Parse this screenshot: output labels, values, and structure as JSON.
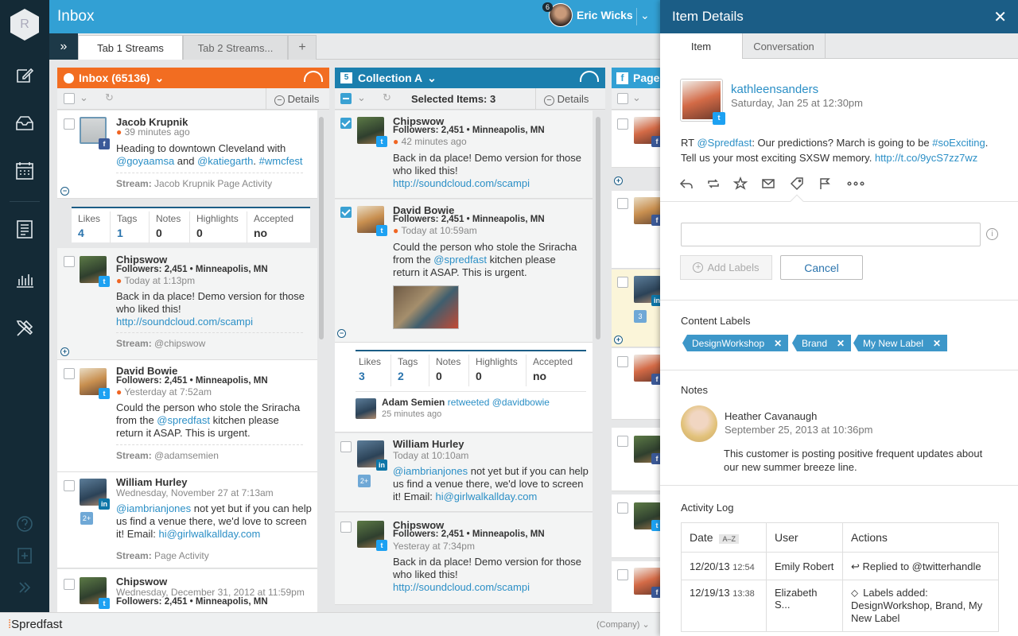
{
  "rail": {
    "logo_letter": "R"
  },
  "header": {
    "title": "Inbox",
    "user_name": "Eric Wicks",
    "notification_count": "6"
  },
  "tabs": [
    {
      "label": "Tab 1 Streams"
    },
    {
      "label": "Tab 2 Streams..."
    },
    {
      "label": "+"
    }
  ],
  "columns": {
    "inbox": {
      "title": "Inbox (65136)",
      "details": "Details",
      "color": "#f26d21"
    },
    "collection": {
      "title": "Collection A",
      "badge": "5",
      "selected": "Selected Items: 3",
      "details": "Details",
      "color": "#1b7fae"
    },
    "page": {
      "title": "Page",
      "color": "#32a0d4"
    }
  },
  "inbox_posts": [
    {
      "name": "Jacob Krupnik",
      "time": "39 minutes ago",
      "text_pre": "Heading to downtown Cleveland with ",
      "mention1": "@goyaamsa",
      "and": " and ",
      "mention2": "@katiegarth",
      "tag": "#wmcfest",
      "stream_label": "Stream:",
      "stream": "Jacob Krupnik Page Activity",
      "network": "f"
    },
    {
      "name": "Chipswow",
      "meta": "Followers: 2,451 • Minneapolis, MN",
      "time": "Today at 1:13pm",
      "text": "Back in da place! Demo version for those who liked this!",
      "link": "http://soundcloud.com/scampi",
      "stream_label": "Stream:",
      "stream": "@chipswow",
      "network": "t"
    },
    {
      "name": "David Bowie",
      "meta": "Followers: 2,451 • Minneapolis, MN",
      "time": "Yesterday at 7:52am",
      "text_pre": "Could the person who stole the Sriracha from the ",
      "mention": "@spredfast",
      "text_post": " kitchen please return it ASAP. This is urgent.",
      "stream_label": "Stream:",
      "stream": "@adamsemien",
      "network": "t"
    },
    {
      "name": "William Hurley",
      "time": "Wednesday, November 27 at 7:13am",
      "mention": "@iambrianjones",
      "text": " not yet but if you can help us find a venue there, we'd love to screen it! Email: ",
      "email": "hi@girlwalkallday.com",
      "stream_label": "Stream:",
      "stream": "Page Activity",
      "network": "in",
      "more": "2+"
    },
    {
      "name": "Chipswow",
      "time": "Wednesday, December 31, 2012 at 11:59pm",
      "meta": "Followers: 2,451 • Minneapolis, MN",
      "network": "t"
    }
  ],
  "inbox_stats": {
    "likes_k": "Likes",
    "likes_v": "4",
    "tags_k": "Tags",
    "tags_v": "1",
    "notes_k": "Notes",
    "notes_v": "0",
    "highlights_k": "Highlights",
    "highlights_v": "0",
    "accepted_k": "Accepted",
    "accepted_v": "no"
  },
  "collection_posts": [
    {
      "name": "Chipswow",
      "meta": "Followers: 2,451 • Minneapolis, MN",
      "time": "42 minutes ago",
      "text": "Back in da place! Demo version for those who liked this!",
      "link": "http://soundcloud.com/scampi"
    },
    {
      "name": "David Bowie",
      "meta": "Followers: 2,451 • Minneapolis, MN",
      "time": "Today at 10:59am",
      "text_pre": "Could the person who stole the Sriracha from the ",
      "mention": "@spredfast",
      "text_post": " kitchen please return it ASAP. This is urgent."
    },
    {
      "name": "William Hurley",
      "time": "Today at 10:10am",
      "mention": "@iambrianjones",
      "text": " not yet but if you can help us find a venue there, we'd love to screen it! Email: ",
      "email": "hi@girlwalkallday.com",
      "more": "2+"
    },
    {
      "name": "Chipswow",
      "meta": "Followers: 2,451 • Minneapolis, MN",
      "time": "Yesteray at 7:34pm",
      "text": "Back in da place! Demo version for those who liked this!",
      "link": "http://soundcloud.com/scampi"
    }
  ],
  "collection_stats": {
    "likes_k": "Likes",
    "likes_v": "3",
    "tags_k": "Tags",
    "tags_v": "2",
    "notes_k": "Notes",
    "notes_v": "0",
    "highlights_k": "Highlights",
    "highlights_v": "0",
    "accepted_k": "Accepted",
    "accepted_v": "no"
  },
  "retweet": {
    "name": "Adam Semien",
    "action": "retweeted",
    "handle": "@davidbowie",
    "time": "25 minutes ago"
  },
  "page_badge": "3",
  "panel": {
    "title": "Item Details",
    "tabs": [
      "Item",
      "Conversation"
    ],
    "author": "kathleensanders",
    "date": "Saturday, Jan 25 at 12:30pm",
    "text_rt": "RT ",
    "mention": "@Spredfast",
    "text_mid": ": Our predictions? March is going to be ",
    "hashtag": "#soExciting",
    "text_end": ". Tell us your most exciting SXSW memory. ",
    "link": "http://t.co/9ycS7zz7wz",
    "add_labels": "Add Labels",
    "cancel": "Cancel",
    "content_labels_title": "Content Labels",
    "labels": [
      "DesignWorkshop",
      "Brand",
      "My New Label"
    ],
    "notes_title": "Notes",
    "note_author": "Heather Cavanaugh",
    "note_date": "September 25, 2013 at 10:36pm",
    "note_text": "This customer is posting positive frequent updates about our new summer breeze line.",
    "activity_title": "Activity Log",
    "log_headers": {
      "date": "Date",
      "sort": "A–Z",
      "user": "User",
      "actions": "Actions"
    },
    "log": [
      {
        "date": "12/20/13",
        "time": "12:54",
        "user": "Emily Robert",
        "action": "Replied to @twitterhandle"
      },
      {
        "date": "12/19/13",
        "time": "13:38",
        "user": "Elizabeth S...",
        "action": "Labels added: DesignWorkshop, Brand, My New Label"
      }
    ]
  },
  "footer": {
    "brand": "Spredfast",
    "company": "(Company)"
  }
}
